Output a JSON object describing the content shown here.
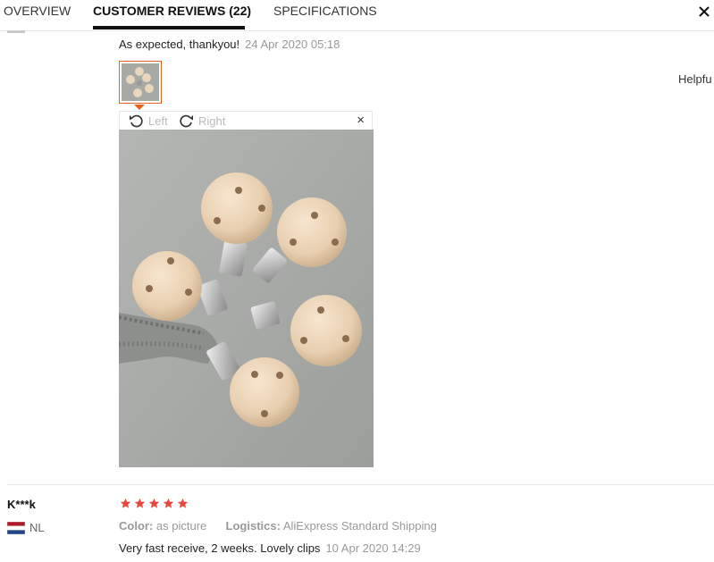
{
  "tabs": [
    {
      "label": "OVERVIEW"
    },
    {
      "label": "CUSTOMER REVIEWS (22)"
    },
    {
      "label": "SPECIFICATIONS"
    }
  ],
  "review_prev": {
    "text": "As expected, thankyou!",
    "date": "24 Apr 2020 05:18",
    "helpful_label": "Helpfu",
    "viewer": {
      "rotate_left_label": "Left",
      "rotate_right_label": "Right",
      "close_symbol": "×"
    }
  },
  "review_next": {
    "name": "K***k",
    "country": "NL",
    "rating": 5,
    "color_label": "Color:",
    "color_value": "as picture",
    "logistics_label": "Logistics:",
    "logistics_value": "AliExpress Standard Shipping",
    "text": "Very fast receive, 2 weeks. Lovely clips",
    "date": "10 Apr 2020 14:29"
  },
  "colors": {
    "accent_orange": "#e8611a",
    "star_red": "#e8483f",
    "text_muted": "#999999"
  }
}
